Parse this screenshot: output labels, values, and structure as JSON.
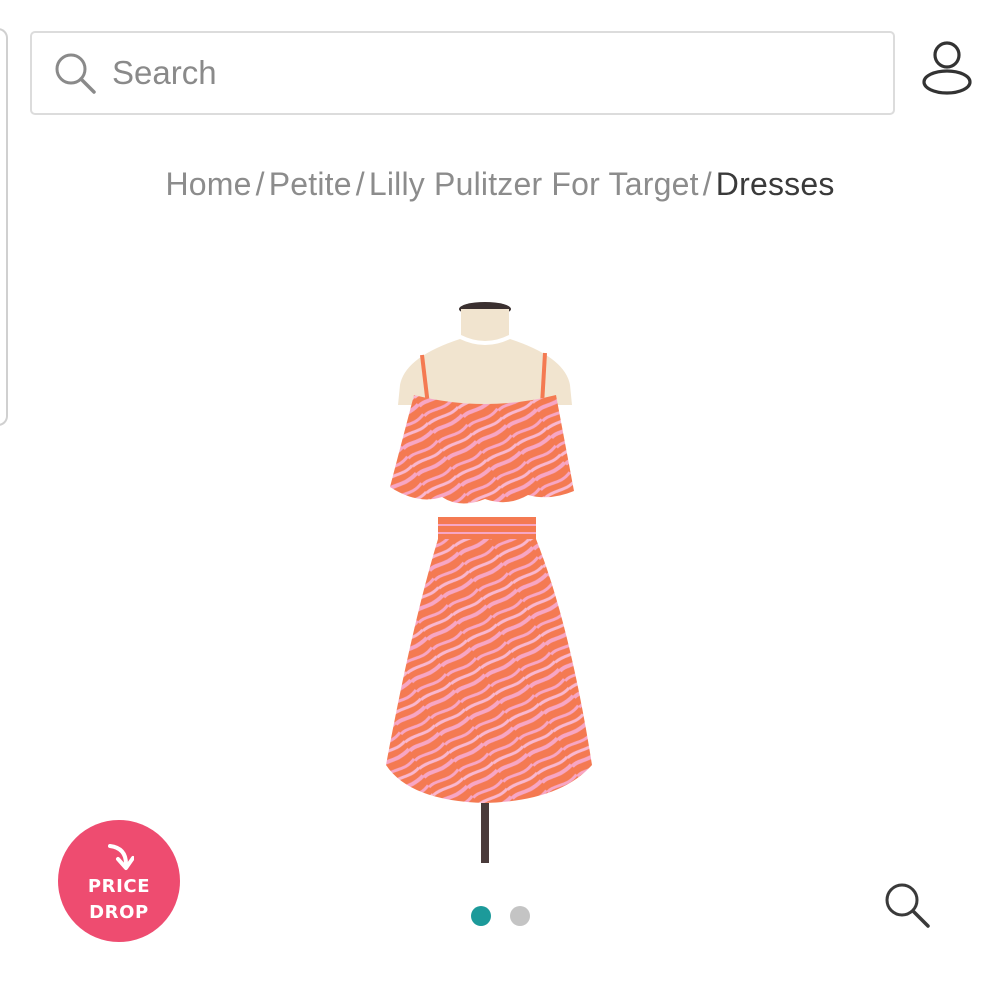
{
  "search": {
    "placeholder": "Search",
    "value": ""
  },
  "header": {
    "account_icon": "user-icon"
  },
  "breadcrumb": {
    "items": [
      "Home",
      "Petite",
      "Lilly Pulitzer For Target"
    ],
    "separator": "/",
    "current": "Dresses"
  },
  "product": {
    "image_alt_icon": "dress-on-mannequin",
    "colors": {
      "dress_base": "#f47a52",
      "dress_pattern": "#f7a6c4",
      "mannequin": "#f1e4cf"
    }
  },
  "badge": {
    "line1": "PRICE",
    "line2": "DROP",
    "color": "#ee4c70",
    "icon": "arrow-down-icon"
  },
  "carousel": {
    "total": 2,
    "active_index": 0,
    "active_color": "#1c9a9a"
  },
  "zoom": {
    "icon": "magnifier-icon"
  }
}
